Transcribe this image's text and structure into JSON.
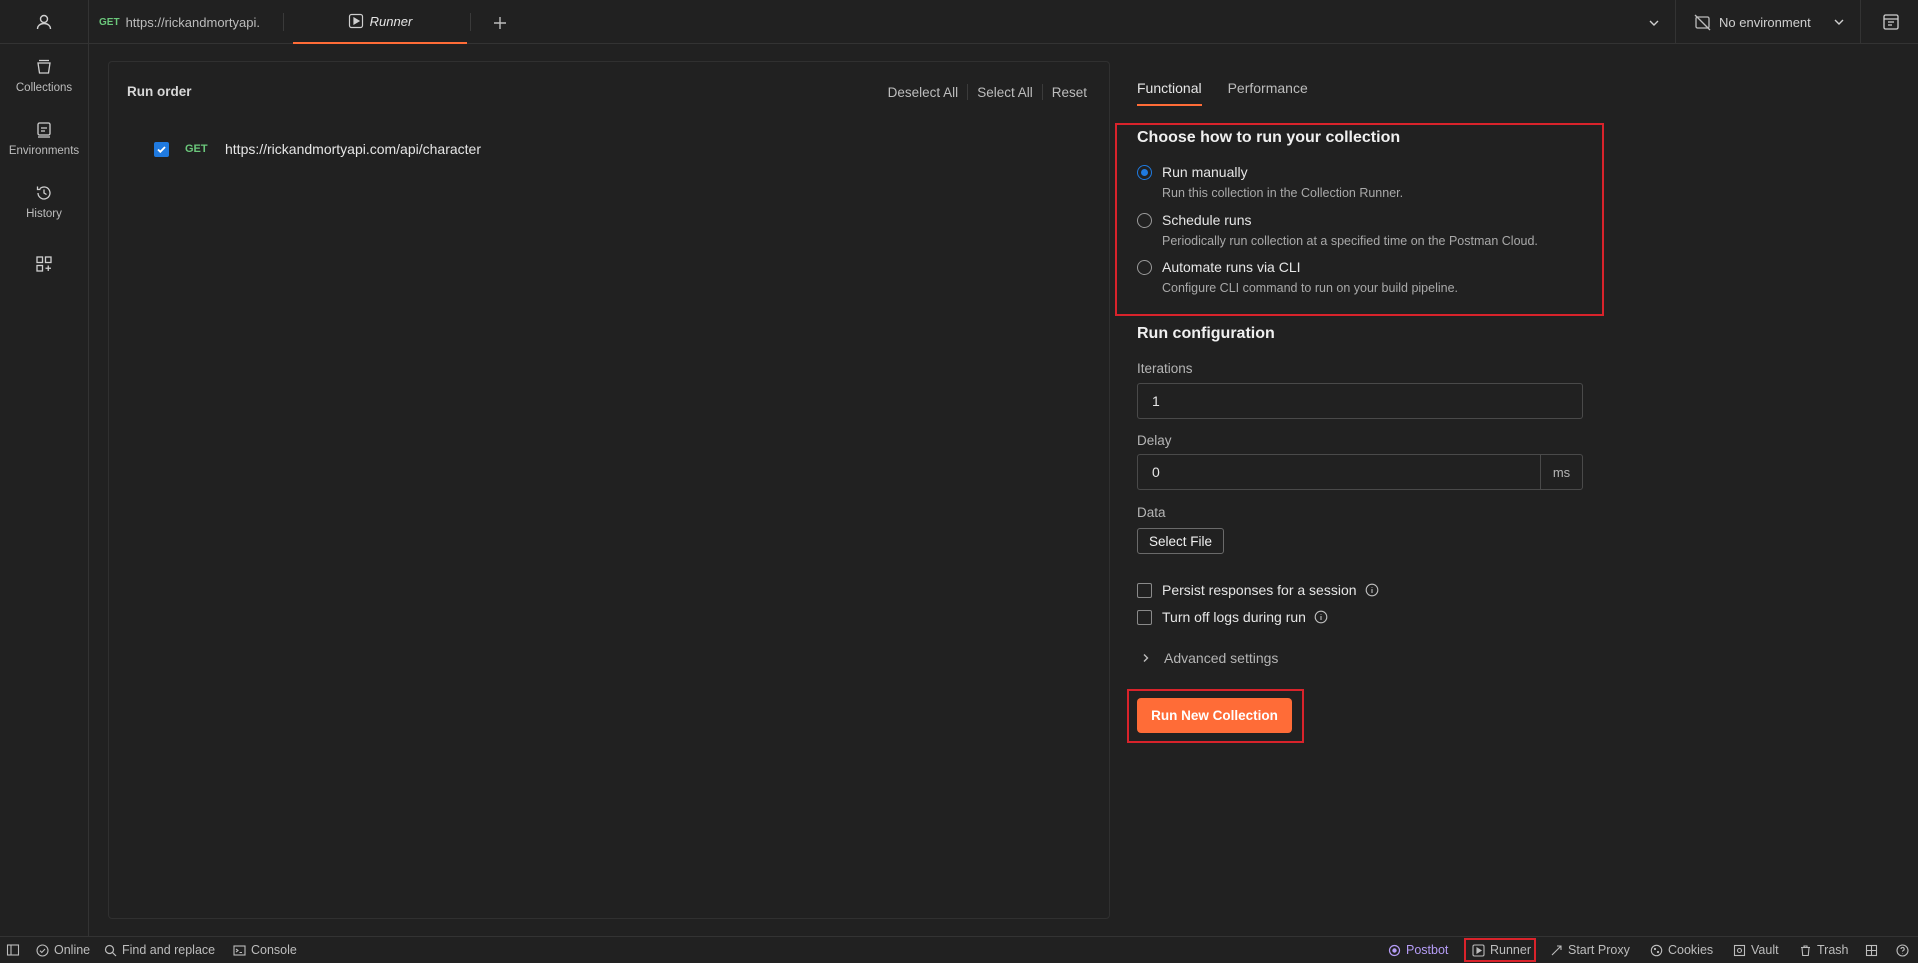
{
  "topbar": {
    "request_tab": {
      "method": "GET",
      "title": "https://rickandmortyapi."
    },
    "runner_tab": {
      "title": "Runner"
    },
    "environment": {
      "label": "No environment"
    }
  },
  "sidebar": {
    "items": [
      {
        "label": "Collections",
        "icon": "collections-icon"
      },
      {
        "label": "Environments",
        "icon": "environments-icon"
      },
      {
        "label": "History",
        "icon": "history-icon"
      }
    ]
  },
  "run_order": {
    "title": "Run order",
    "actions": {
      "deselect_all": "Deselect All",
      "select_all": "Select All",
      "reset": "Reset"
    },
    "requests": [
      {
        "checked": true,
        "method": "GET",
        "url": "https://rickandmortyapi.com/api/character"
      }
    ]
  },
  "right_panel": {
    "tabs": [
      {
        "label": "Functional",
        "active": true
      },
      {
        "label": "Performance",
        "active": false
      }
    ],
    "run_mode": {
      "title": "Choose how to run your collection",
      "options": [
        {
          "label": "Run manually",
          "description": "Run this collection in the Collection Runner.",
          "selected": true
        },
        {
          "label": "Schedule runs",
          "description": "Periodically run collection at a specified time on the Postman Cloud.",
          "selected": false
        },
        {
          "label": "Automate runs via CLI",
          "description": "Configure CLI command to run on your build pipeline.",
          "selected": false
        }
      ]
    },
    "config": {
      "title": "Run configuration",
      "iterations_label": "Iterations",
      "iterations_value": "1",
      "delay_label": "Delay",
      "delay_value": "0",
      "delay_unit": "ms",
      "data_label": "Data",
      "select_file": "Select File",
      "persist_responses": "Persist responses for a session",
      "turn_off_logs": "Turn off logs during run",
      "advanced": "Advanced settings"
    },
    "run_button": "Run New Collection"
  },
  "statusbar": {
    "online": "Online",
    "find_replace": "Find and replace",
    "console": "Console",
    "postbot": "Postbot",
    "runner": "Runner",
    "start_proxy": "Start Proxy",
    "cookies": "Cookies",
    "vault": "Vault",
    "trash": "Trash"
  },
  "colors": {
    "accent": "#ff6c37",
    "checkbox": "#1f7ae0",
    "get_method": "#6bc77b",
    "highlight": "#d9232b"
  }
}
